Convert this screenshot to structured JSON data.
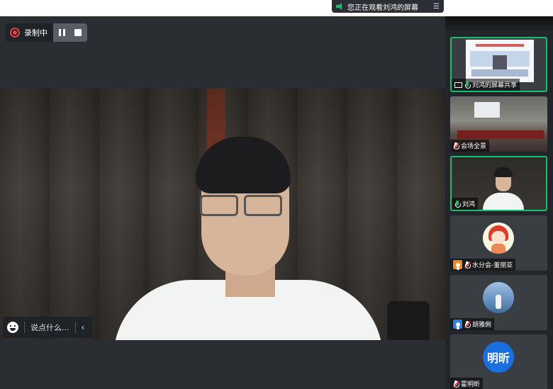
{
  "viewing_banner": {
    "text": "您正在观看刘鸿的屏幕"
  },
  "recording": {
    "label": "录制中"
  },
  "chat": {
    "placeholder": "说点什么..."
  },
  "participants": [
    {
      "name": "刘鸿的屏幕共享",
      "type": "screen-share",
      "active": true
    },
    {
      "name": "会场全景",
      "type": "video",
      "active": false
    },
    {
      "name": "刘鸿",
      "type": "video",
      "active": true
    },
    {
      "name": "水分会-董丽亚",
      "type": "avatar",
      "active": false
    },
    {
      "name": "胡雅俐",
      "type": "avatar",
      "active": false
    },
    {
      "name": "霍明昕",
      "type": "avatar-text",
      "avatar_text": "明昕",
      "active": false
    }
  ],
  "colors": {
    "accent": "#19c06b",
    "recording": "#e04545",
    "avatar_blue": "#1a6fe0"
  }
}
